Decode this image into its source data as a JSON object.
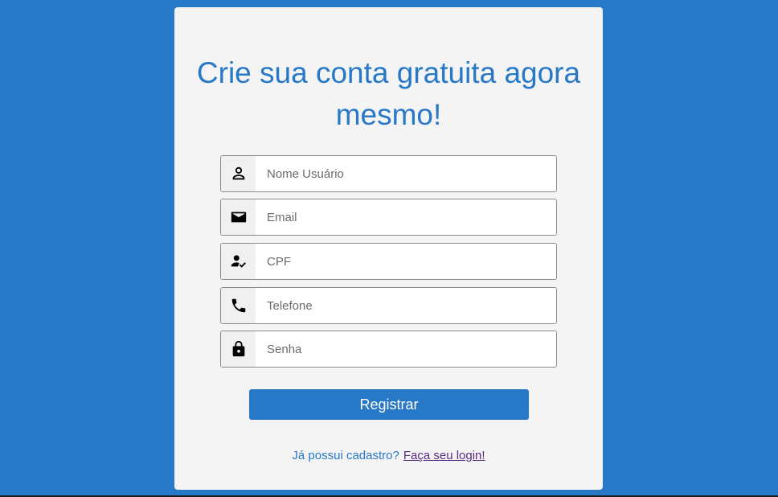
{
  "form": {
    "title": "Crie sua conta gratuita agora mesmo!",
    "fields": [
      {
        "icon": "person-icon",
        "placeholder": "Nome Usuário",
        "value": ""
      },
      {
        "icon": "mail-icon",
        "placeholder": "Email",
        "value": ""
      },
      {
        "icon": "person-check-icon",
        "placeholder": "CPF",
        "value": ""
      },
      {
        "icon": "phone-icon",
        "placeholder": "Telefone",
        "value": ""
      },
      {
        "icon": "lock-icon",
        "placeholder": "Senha",
        "value": ""
      }
    ],
    "register_label": "Registrar",
    "login_prompt": "Já possui cadastro?",
    "login_link": "Faça seu login!"
  },
  "colors": {
    "background": "#2878c8",
    "card": "#f4f4f4",
    "accent": "#2878c8",
    "link_visited": "#5a2a82"
  }
}
